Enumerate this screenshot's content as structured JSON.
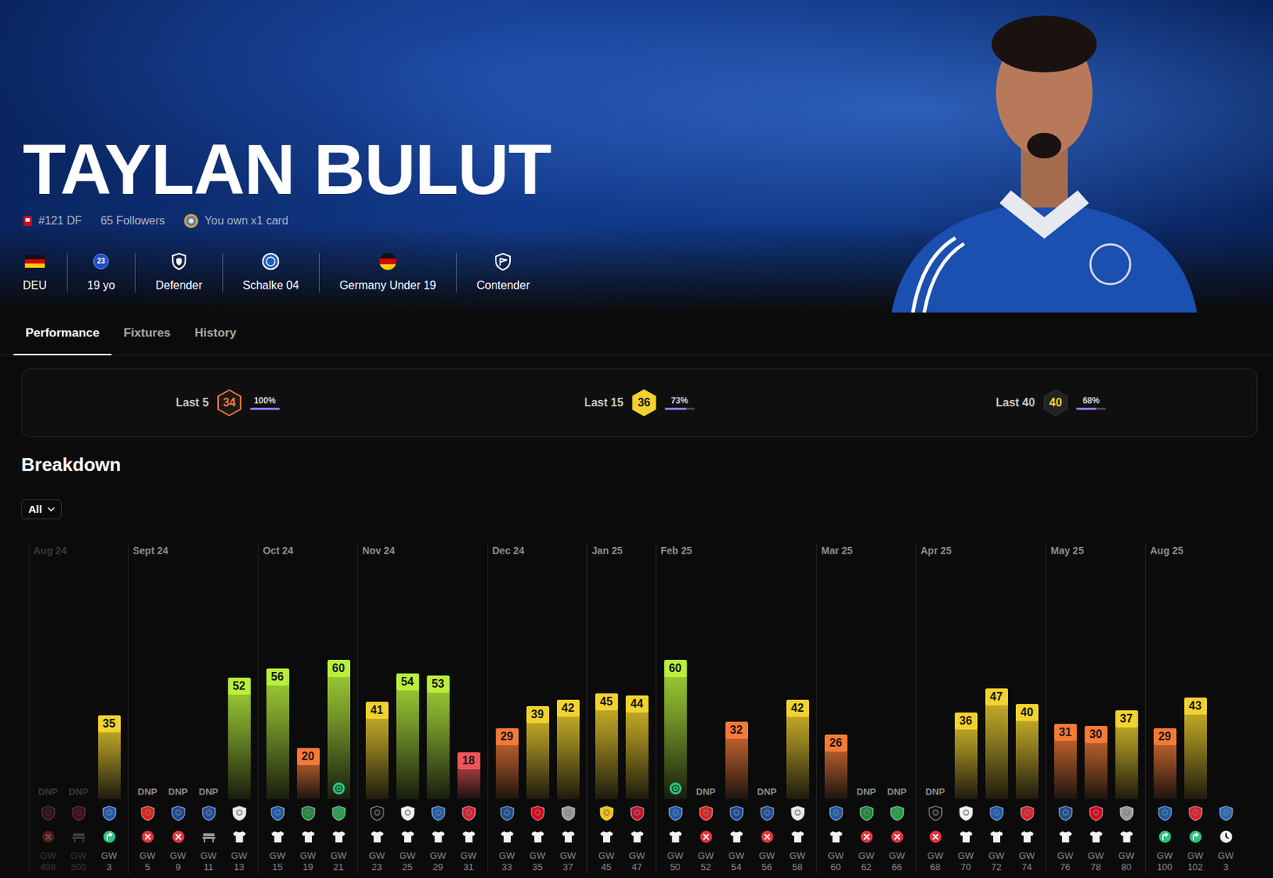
{
  "player": {
    "name": "TAYLAN BULUT",
    "meta": [
      {
        "kind": "rank",
        "text": "#121 DF"
      },
      {
        "kind": "followers",
        "text": "65 Followers"
      },
      {
        "kind": "cards",
        "text": "You own x1 card"
      }
    ],
    "info": [
      {
        "kind": "flag",
        "label": "DEU"
      },
      {
        "kind": "age",
        "badge": "23",
        "label": "19 yo"
      },
      {
        "kind": "position",
        "label": "Defender"
      },
      {
        "kind": "club",
        "label": "Schalke 04"
      },
      {
        "kind": "team",
        "label": "Germany Under 19"
      },
      {
        "kind": "tier",
        "label": "Contender"
      }
    ]
  },
  "tabs": [
    {
      "label": "Performance",
      "selected": true
    },
    {
      "label": "Fixtures",
      "selected": false
    },
    {
      "label": "History",
      "selected": false
    }
  ],
  "scores": [
    {
      "label": "Last 5",
      "score": "34",
      "kind": "outline",
      "color": "#f47a36",
      "percent": "100%",
      "level": 1.0
    },
    {
      "label": "Last 15",
      "score": "36",
      "kind": "filled",
      "color": "#f2d22e",
      "percent": "73%",
      "level": 0.73
    },
    {
      "label": "Last 40",
      "score": "40",
      "kind": "dim",
      "color": "#f2d22e",
      "percent": "68%",
      "level": 0.68
    }
  ],
  "breakdown": {
    "title": "Breakdown",
    "filter": "All"
  },
  "months": [
    {
      "label": "Aug 24",
      "faded": true,
      "games": [
        {
          "gw": "GW 498",
          "value": null,
          "label": "DNP",
          "kind": "absent",
          "faded": true,
          "award": false,
          "opponent": {
            "color": "#8b2020"
          }
        },
        {
          "gw": "GW 500",
          "value": null,
          "label": "DNP",
          "kind": "bench",
          "faded": true,
          "award": false,
          "opponent": {
            "color": "#c8102e"
          }
        },
        {
          "gw": "GW 3",
          "value": 35,
          "label": "35",
          "color": "#f2d22e",
          "kind": "sub",
          "faded": false,
          "award": false,
          "opponent": {
            "color": "#1e5bb5"
          }
        }
      ]
    },
    {
      "label": "Sept 24",
      "faded": false,
      "games": [
        {
          "gw": "GW 5",
          "value": null,
          "label": "DNP",
          "kind": "absent",
          "faded": false,
          "award": false,
          "opponent": {
            "color": "#e32219"
          }
        },
        {
          "gw": "GW 9",
          "value": null,
          "label": "DNP",
          "kind": "absent",
          "faded": false,
          "award": false,
          "opponent": {
            "color": "#1a4b9c"
          }
        },
        {
          "gw": "GW 11",
          "value": null,
          "label": "DNP",
          "kind": "bench",
          "faded": false,
          "award": false,
          "opponent": {
            "color": "#1f4fa0"
          }
        },
        {
          "gw": "GW 13",
          "value": 52,
          "label": "52",
          "color": "#b8f03c",
          "kind": "starter",
          "faded": false,
          "award": false,
          "opponent": {
            "color": "#e8e8e8"
          }
        }
      ]
    },
    {
      "label": "Oct 24",
      "faded": false,
      "games": [
        {
          "gw": "GW 15",
          "value": 56,
          "label": "56",
          "color": "#b8f03c",
          "kind": "starter",
          "faded": false,
          "award": false,
          "opponent": {
            "color": "#1c5cab"
          }
        },
        {
          "gw": "GW 19",
          "value": 20,
          "label": "20",
          "color": "#f47a36",
          "kind": "starter",
          "faded": false,
          "award": false,
          "opponent": {
            "color": "#1f8a3b"
          }
        },
        {
          "gw": "GW 21",
          "value": 60,
          "label": "60",
          "color": "#b8f03c",
          "kind": "starter",
          "faded": false,
          "award": true,
          "opponent": {
            "color": "#1fa34a"
          }
        }
      ]
    },
    {
      "label": "Nov 24",
      "faded": false,
      "games": [
        {
          "gw": "GW 23",
          "value": 41,
          "label": "41",
          "color": "#f2d22e",
          "kind": "starter",
          "faded": false,
          "award": false,
          "opponent": {
            "color": "#111111"
          }
        },
        {
          "gw": "GW 25",
          "value": 54,
          "label": "54",
          "color": "#b8f03c",
          "kind": "starter",
          "faded": false,
          "award": false,
          "opponent": {
            "color": "#f2f2f2"
          }
        },
        {
          "gw": "GW 29",
          "value": 53,
          "label": "53",
          "color": "#b8f03c",
          "kind": "starter",
          "faded": false,
          "award": false,
          "opponent": {
            "color": "#1b5fb0"
          }
        },
        {
          "gw": "GW 31",
          "value": 18,
          "label": "18",
          "color": "#f0555a",
          "kind": "starter",
          "faded": false,
          "award": false,
          "opponent": {
            "color": "#e0202f"
          }
        }
      ]
    },
    {
      "label": "Dec 24",
      "faded": false,
      "games": [
        {
          "gw": "GW 33",
          "value": 29,
          "label": "29",
          "color": "#f47a36",
          "kind": "starter",
          "faded": false,
          "award": false,
          "opponent": {
            "color": "#1d4f91"
          }
        },
        {
          "gw": "GW 35",
          "value": 39,
          "label": "39",
          "color": "#f2d22e",
          "kind": "starter",
          "faded": false,
          "award": false,
          "opponent": {
            "color": "#e2001a"
          }
        },
        {
          "gw": "GW 37",
          "value": 42,
          "label": "42",
          "color": "#f2d22e",
          "kind": "starter",
          "faded": false,
          "award": false,
          "opponent": {
            "color": "#9a9a9a"
          }
        }
      ]
    },
    {
      "label": "Jan 25",
      "faded": false,
      "games": [
        {
          "gw": "GW 45",
          "value": 45,
          "label": "45",
          "color": "#f2d22e",
          "kind": "starter",
          "faded": false,
          "award": false,
          "opponent": {
            "color": "#f4c400"
          }
        },
        {
          "gw": "GW 47",
          "value": 44,
          "label": "44",
          "color": "#f2d22e",
          "kind": "starter",
          "faded": false,
          "award": false,
          "opponent": {
            "color": "#c8102e"
          }
        }
      ]
    },
    {
      "label": "Feb 25",
      "faded": false,
      "games": [
        {
          "gw": "GW 50",
          "value": 60,
          "label": "60",
          "color": "#b8f03c",
          "kind": "starter",
          "faded": false,
          "award": true,
          "opponent": {
            "color": "#1e5bb5"
          }
        },
        {
          "gw": "GW 52",
          "value": null,
          "label": "DNP",
          "kind": "absent",
          "faded": false,
          "award": false,
          "opponent": {
            "color": "#e32219"
          }
        },
        {
          "gw": "GW 54",
          "value": 32,
          "label": "32",
          "color": "#f47a36",
          "kind": "starter",
          "faded": false,
          "award": false,
          "opponent": {
            "color": "#1a4b9c"
          }
        },
        {
          "gw": "GW 56",
          "value": null,
          "label": "DNP",
          "kind": "absent",
          "faded": false,
          "award": false,
          "opponent": {
            "color": "#1f4fa0"
          }
        },
        {
          "gw": "GW 58",
          "value": 42,
          "label": "42",
          "color": "#f2d22e",
          "kind": "starter",
          "faded": false,
          "award": false,
          "opponent": {
            "color": "#e8e8e8"
          }
        }
      ]
    },
    {
      "label": "Mar 25",
      "faded": false,
      "games": [
        {
          "gw": "GW 60",
          "value": 26,
          "label": "26",
          "color": "#f47a36",
          "kind": "starter",
          "faded": false,
          "award": false,
          "opponent": {
            "color": "#1c5cab"
          }
        },
        {
          "gw": "GW 62",
          "value": null,
          "label": "DNP",
          "kind": "absent",
          "faded": false,
          "award": false,
          "opponent": {
            "color": "#1f8a3b"
          }
        },
        {
          "gw": "GW 66",
          "value": null,
          "label": "DNP",
          "kind": "absent",
          "faded": false,
          "award": false,
          "opponent": {
            "color": "#1fa34a"
          }
        }
      ]
    },
    {
      "label": "Apr 25",
      "faded": false,
      "games": [
        {
          "gw": "GW 68",
          "value": null,
          "label": "DNP",
          "kind": "absent",
          "faded": false,
          "award": false,
          "opponent": {
            "color": "#111111"
          }
        },
        {
          "gw": "GW 70",
          "value": 36,
          "label": "36",
          "color": "#f2d22e",
          "kind": "starter",
          "faded": false,
          "award": false,
          "opponent": {
            "color": "#f2f2f2"
          }
        },
        {
          "gw": "GW 72",
          "value": 47,
          "label": "47",
          "color": "#f2d22e",
          "kind": "starter",
          "faded": false,
          "award": false,
          "opponent": {
            "color": "#1b5fb0"
          }
        },
        {
          "gw": "GW 74",
          "value": 40,
          "label": "40",
          "color": "#f2d22e",
          "kind": "starter",
          "faded": false,
          "award": false,
          "opponent": {
            "color": "#e0202f"
          }
        }
      ]
    },
    {
      "label": "May 25",
      "faded": false,
      "games": [
        {
          "gw": "GW 76",
          "value": 31,
          "label": "31",
          "color": "#f47a36",
          "kind": "starter",
          "faded": false,
          "award": false,
          "opponent": {
            "color": "#1d4f91"
          }
        },
        {
          "gw": "GW 78",
          "value": 30,
          "label": "30",
          "color": "#f47a36",
          "kind": "starter",
          "faded": false,
          "award": false,
          "opponent": {
            "color": "#e2001a"
          }
        },
        {
          "gw": "GW 80",
          "value": 37,
          "label": "37",
          "color": "#f2d22e",
          "kind": "starter",
          "faded": false,
          "award": false,
          "opponent": {
            "color": "#9a9a9a"
          }
        }
      ]
    },
    {
      "label": "Aug 25",
      "faded": false,
      "games": [
        {
          "gw": "GW 100",
          "value": 29,
          "label": "29",
          "color": "#f47a36",
          "kind": "sub",
          "faded": false,
          "award": false,
          "opponent": {
            "color": "#1c5cab"
          }
        },
        {
          "gw": "GW 102",
          "value": 43,
          "label": "43",
          "color": "#f2d22e",
          "kind": "sub",
          "faded": false,
          "award": false,
          "opponent": {
            "color": "#e0202f"
          }
        },
        {
          "gw": "GW 3",
          "value": null,
          "kind": "upcoming",
          "faded": false,
          "award": false,
          "opponent": {
            "color": "#2a6ab8"
          }
        }
      ]
    }
  ]
}
